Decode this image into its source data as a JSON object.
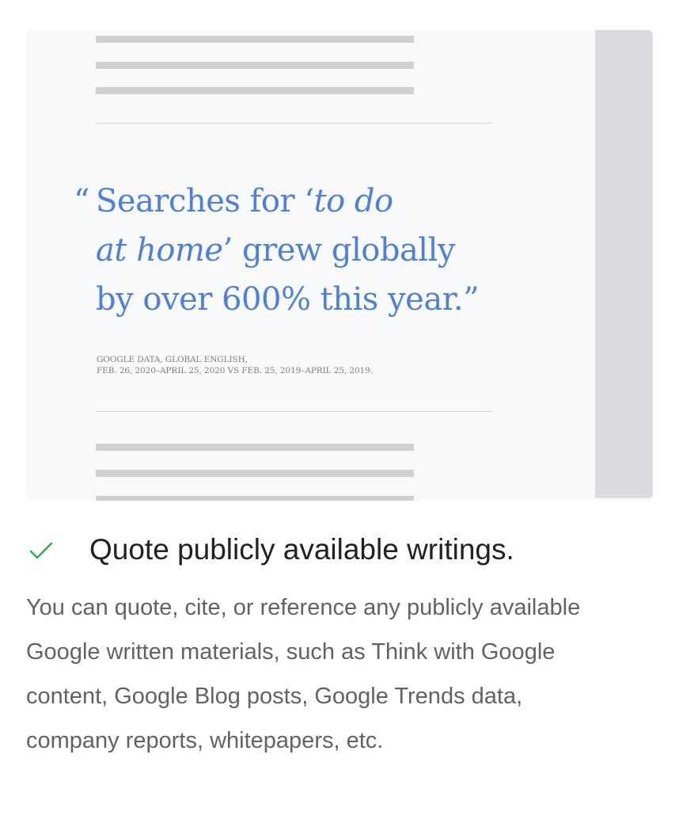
{
  "illustration": {
    "quote_open_mark": "“",
    "quote_line1_pre": "Searches for ‘",
    "quote_line1_em": "to do",
    "quote_line2_em": "at home",
    "quote_line2_post": "’ grew globally",
    "quote_line3": "by over 600% this year.”",
    "source_line1": "GOOGLE DATA, GLOBAL ENGLISH,",
    "source_line2": "FEB. 26, 2020–APRIL 25, 2020 VS FEB. 25, 2019–APRIL 25, 2019."
  },
  "guideline": {
    "icon": "checkmark-icon",
    "check_color": "#34a853",
    "title": "Quote publicly available writings.",
    "description_lines": [
      "You can quote, cite, or reference any publicly available",
      "Google written materials, such as Think with Google",
      "content, Google Blog posts, Google Trends data,",
      "company reports, whitepapers, etc."
    ]
  },
  "colors": {
    "quote_blue": "#4f7fd6",
    "title_text": "#202124",
    "body_text": "#5f6368",
    "card_background": "#f8f9fa",
    "placeholder_bar": "#cfd0d2"
  }
}
